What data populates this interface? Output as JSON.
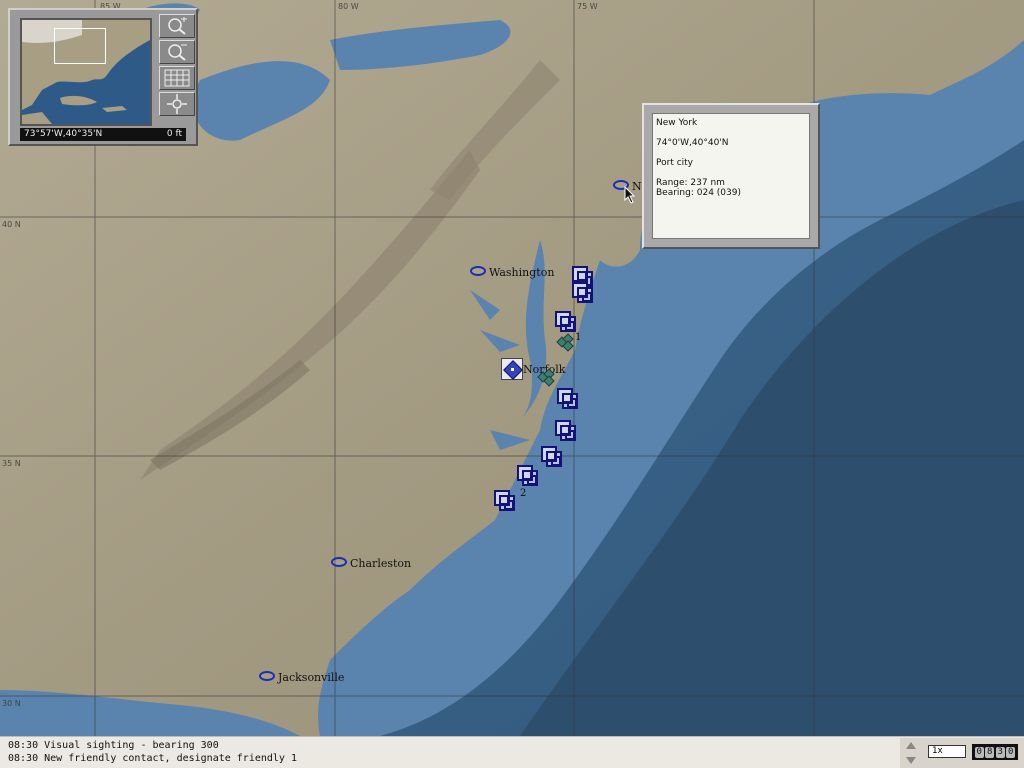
{
  "map": {
    "grid_labels": {
      "lon80": "80 W",
      "lon75": "75 W",
      "lon85": "85 W",
      "lat40": "40 N",
      "lat35": "35 N",
      "lat30": "30 N"
    },
    "cities": {
      "new_york": "N",
      "washington": "Washington",
      "norfolk": "Norfolk",
      "charleston": "Charleston",
      "jacksonville": "Jacksonville"
    },
    "unit_numbers": {
      "u1": "1",
      "u2": "2"
    }
  },
  "overview": {
    "coords": "73°57'W,40°35'N",
    "altitude": "0 ft",
    "tools": [
      "zoom-in-icon",
      "zoom-out-icon",
      "grid-icon",
      "center-icon"
    ]
  },
  "info": {
    "name": "New York",
    "coords": "74°0'W,40°40'N",
    "type": "Port city",
    "range": "Range: 237 nm",
    "bearing": "Bearing: 024 (039)"
  },
  "messages": [
    "08:30 Visual sighting - bearing 300",
    "08:30 New friendly contact, designate friendly 1"
  ],
  "time": {
    "speed": "1x",
    "clock": [
      "0",
      "8",
      "3",
      "0"
    ]
  }
}
